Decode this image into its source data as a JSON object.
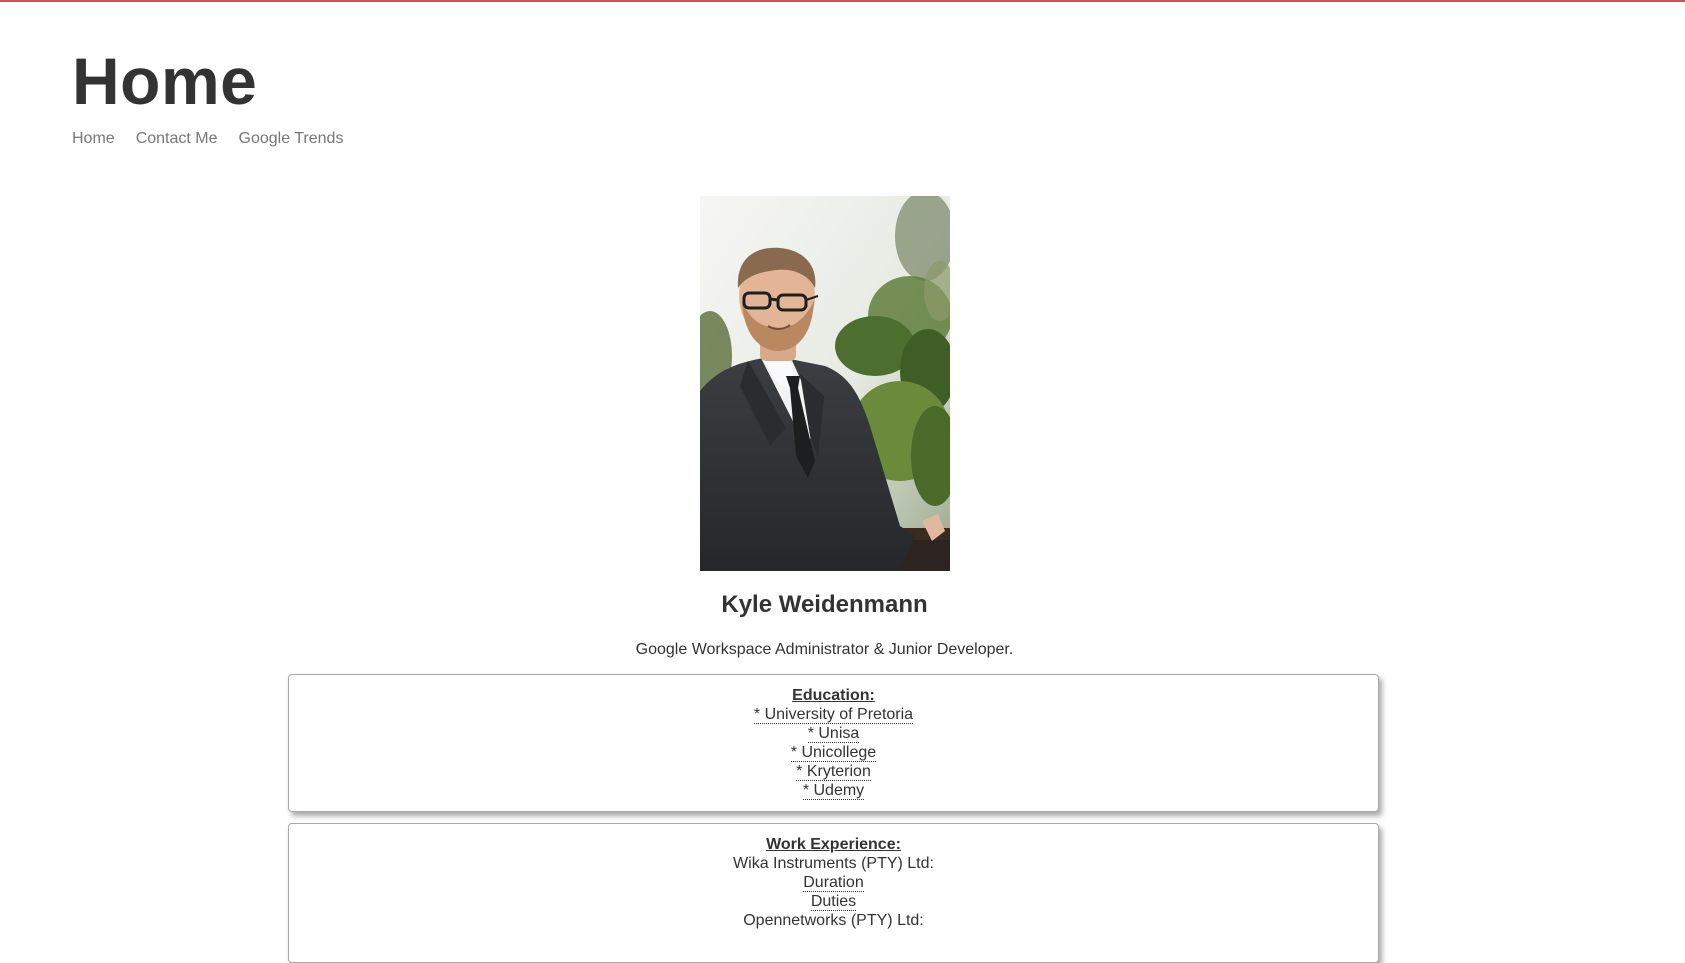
{
  "header": {
    "title": "Home",
    "nav": [
      "Home",
      "Contact Me",
      "Google Trends"
    ]
  },
  "profile": {
    "name": "Kyle Weidenmann",
    "role": "Google Workspace Administrator & Junior Developer."
  },
  "education": {
    "heading": "Education:",
    "items": [
      "* University of Pretoria",
      "* Unisa",
      "* Unicollege",
      "* Kryterion",
      "* Udemy"
    ]
  },
  "work": {
    "heading": "Work Experience:",
    "company1": "Wika Instruments (PTY) Ltd:",
    "duration": "Duration",
    "duties": "Duties",
    "company2": "Opennetworks (PTY) Ltd:"
  },
  "colors": {
    "accent": "#c9535a",
    "text": "#333333",
    "nav": "#777777"
  }
}
